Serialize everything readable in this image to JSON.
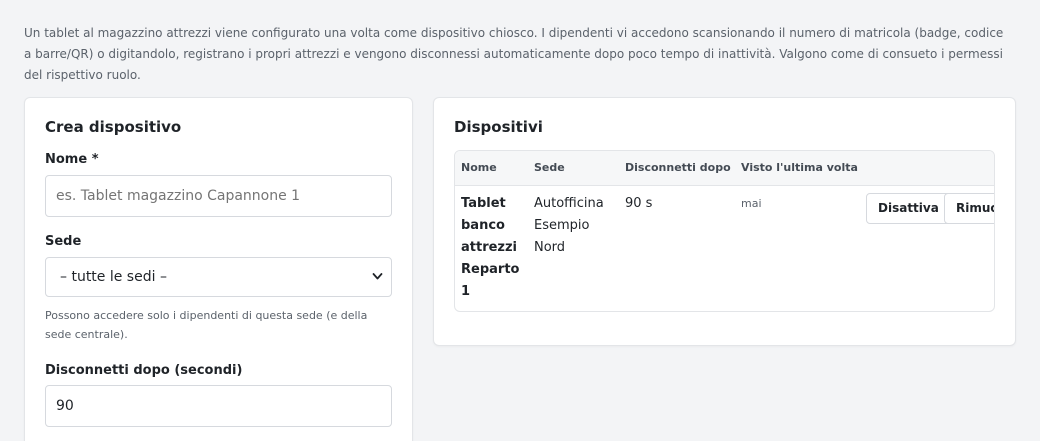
{
  "intro_text": "Un tablet al magazzino attrezzi viene configurato una volta come dispositivo chiosco. I dipendenti vi accedono scansionando il numero di matricola (badge, codice a barre/QR) o digitandolo, registrano i propri attrezzi e vengono disconnessi automaticamente dopo poco tempo di inattività. Valgono come di consueto i permessi del rispettivo ruolo.",
  "create": {
    "title": "Crea dispositivo",
    "name_label": "Nome *",
    "name_placeholder": "es. Tablet magazzino Capannone 1",
    "site_label": "Sede",
    "site_selected": "– tutte le sedi –",
    "site_help": "Possono accedere solo i dipendenti di questa sede (e della sede centrale).",
    "logout_label": "Disconnetti dopo (secondi)",
    "logout_value": "90"
  },
  "devices": {
    "title": "Dispositivi",
    "columns": {
      "name": "Nome",
      "site": "Sede",
      "logout": "Disconnetti dopo",
      "last_seen": "Visto l'ultima volta"
    },
    "rows": [
      {
        "name_lines": [
          "Tablet",
          "banco",
          "attrezzi",
          "Reparto",
          "1"
        ],
        "site_lines": [
          "Autofficina",
          "Esempio",
          "Nord"
        ],
        "logout": "90 s",
        "last_seen": "mai",
        "deactivate_label": "Disattiva",
        "remove_label": "Rimuovi"
      }
    ]
  },
  "icons": {
    "select_chevron": "chevron-down-icon"
  }
}
